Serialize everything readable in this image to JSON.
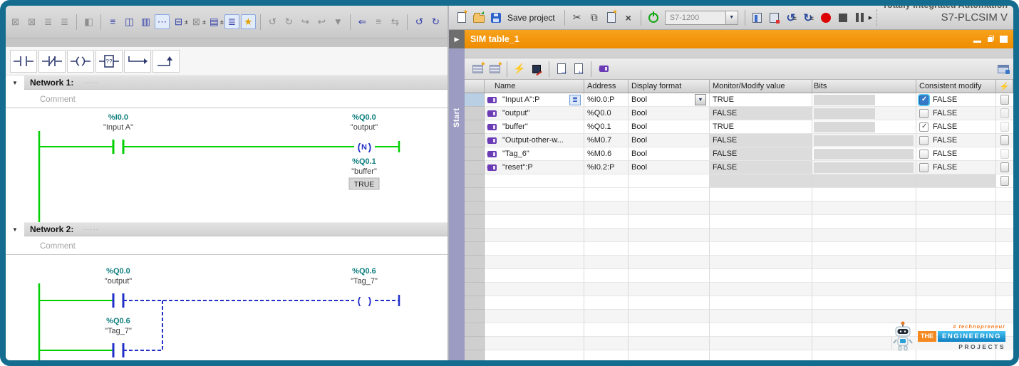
{
  "glyphs": {
    "pm": "±",
    "cut": "✂",
    "copy": "⧉",
    "delete": "×",
    "undo": "↺",
    "redo": "↻",
    "zap": "⚡",
    "arrow_r": "→",
    "arrow_l": "←",
    "more": "▸",
    "play": "▶",
    "tri_down": "▼",
    "dots3": "⋯",
    "list": "≣"
  },
  "lad_toolbar": {
    "icons": [
      {
        "name": "disconnect",
        "g": "⊠"
      },
      {
        "name": "connect",
        "g": "⊠"
      },
      {
        "name": "insert-network",
        "g": "≣"
      },
      {
        "name": "add-block",
        "g": "≣"
      },
      {
        "name": "keep-values",
        "g": "◧"
      },
      {
        "name": "open-all-networks",
        "g": "≡"
      },
      {
        "name": "close-all-networks",
        "g": "◫"
      },
      {
        "name": "split-editor",
        "g": "▥"
      },
      {
        "name": "comments-toggle",
        "g": "⋯"
      },
      {
        "name": "absolute-operands",
        "g": "⊟"
      },
      {
        "name": "operand-representation",
        "g": "⊠"
      },
      {
        "name": "symbol-information",
        "g": "▤"
      },
      {
        "name": "network-titles",
        "g": "≣"
      },
      {
        "name": "favorites",
        "g": "★"
      },
      {
        "name": "previous-error",
        "g": "↺"
      },
      {
        "name": "next-error",
        "g": "↻"
      },
      {
        "name": "update-block-calls",
        "g": "↪"
      },
      {
        "name": "sync-online",
        "g": "↩"
      },
      {
        "name": "consistency-check",
        "g": "▼"
      },
      {
        "name": "go-to-definition",
        "g": "⇐"
      },
      {
        "name": "call-structure",
        "g": "≡"
      },
      {
        "name": "cross-references",
        "g": "⇆"
      },
      {
        "name": "go-online",
        "g": "↺"
      },
      {
        "name": "go-offline",
        "g": "↻"
      }
    ]
  },
  "lad": {
    "networks": [
      {
        "title": "Network 1:",
        "dots": "·····",
        "comment": "Comment"
      },
      {
        "title": "Network 2:",
        "dots": "·····",
        "comment": "Comment"
      }
    ],
    "net1": {
      "contact_addr": "%I0.0",
      "contact_name": "\"Input A\"",
      "coil_addr": "%Q0.0",
      "coil_name": "\"output\"",
      "coil_type": "N",
      "edge_addr": "%Q0.1",
      "edge_name": "\"buffer\"",
      "edge_value": "TRUE"
    },
    "net2": {
      "contact1_addr": "%Q0.0",
      "contact1_name": "\"output\"",
      "contact2_addr": "%Q0.6",
      "contact2_name": "\"Tag_7\"",
      "coil_addr": "%Q0.6",
      "coil_name": "\"Tag_7\""
    }
  },
  "plcsim": {
    "brand_line1": "Totally Integrated Automation",
    "brand_line2": "S7-PLCSIM V",
    "toolbar": {
      "save_label": "Save project",
      "cpu_model": "S7-1200"
    },
    "titlebar": {
      "title": "SIM table_1"
    },
    "start_tab_label": "Start",
    "table": {
      "columns": {
        "name": "Name",
        "address": "Address",
        "format": "Display format",
        "monitor": "Monitor/Modify value",
        "bits": "Bits",
        "consistent": "Consistent modify"
      },
      "rows": [
        {
          "name": "\"Input A\":P",
          "address": "%I0.0:P",
          "format": "Bool",
          "monitor": "TRUE",
          "consistent": "FALSE"
        },
        {
          "name": "\"output\"",
          "address": "%Q0.0",
          "format": "Bool",
          "monitor": "FALSE",
          "consistent": "FALSE"
        },
        {
          "name": "\"buffer\"",
          "address": "%Q0.1",
          "format": "Bool",
          "monitor": "TRUE",
          "consistent": "FALSE"
        },
        {
          "name": "\"Output-other-w...",
          "address": "%M0.7",
          "format": "Bool",
          "monitor": "FALSE",
          "consistent": "FALSE"
        },
        {
          "name": "\"Tag_6\"",
          "address": "%M0.6",
          "format": "Bool",
          "monitor": "FALSE",
          "consistent": "FALSE"
        },
        {
          "name": "\"reset\":P",
          "address": "%I0.2:P",
          "format": "Bool",
          "monitor": "FALSE",
          "consistent": "FALSE"
        }
      ]
    }
  },
  "logo": {
    "tagline": "# technopreneur",
    "word1": "THE",
    "word2": "ENGINEERING",
    "word3": "PROJECTS"
  },
  "colors": {
    "power_flow_green": "#00cf00",
    "power_off_blue": "#2230c8",
    "address_teal": "#0f7e7e",
    "titlebar_orange": "#ee8c00",
    "frame_teal": "#146c8e"
  }
}
